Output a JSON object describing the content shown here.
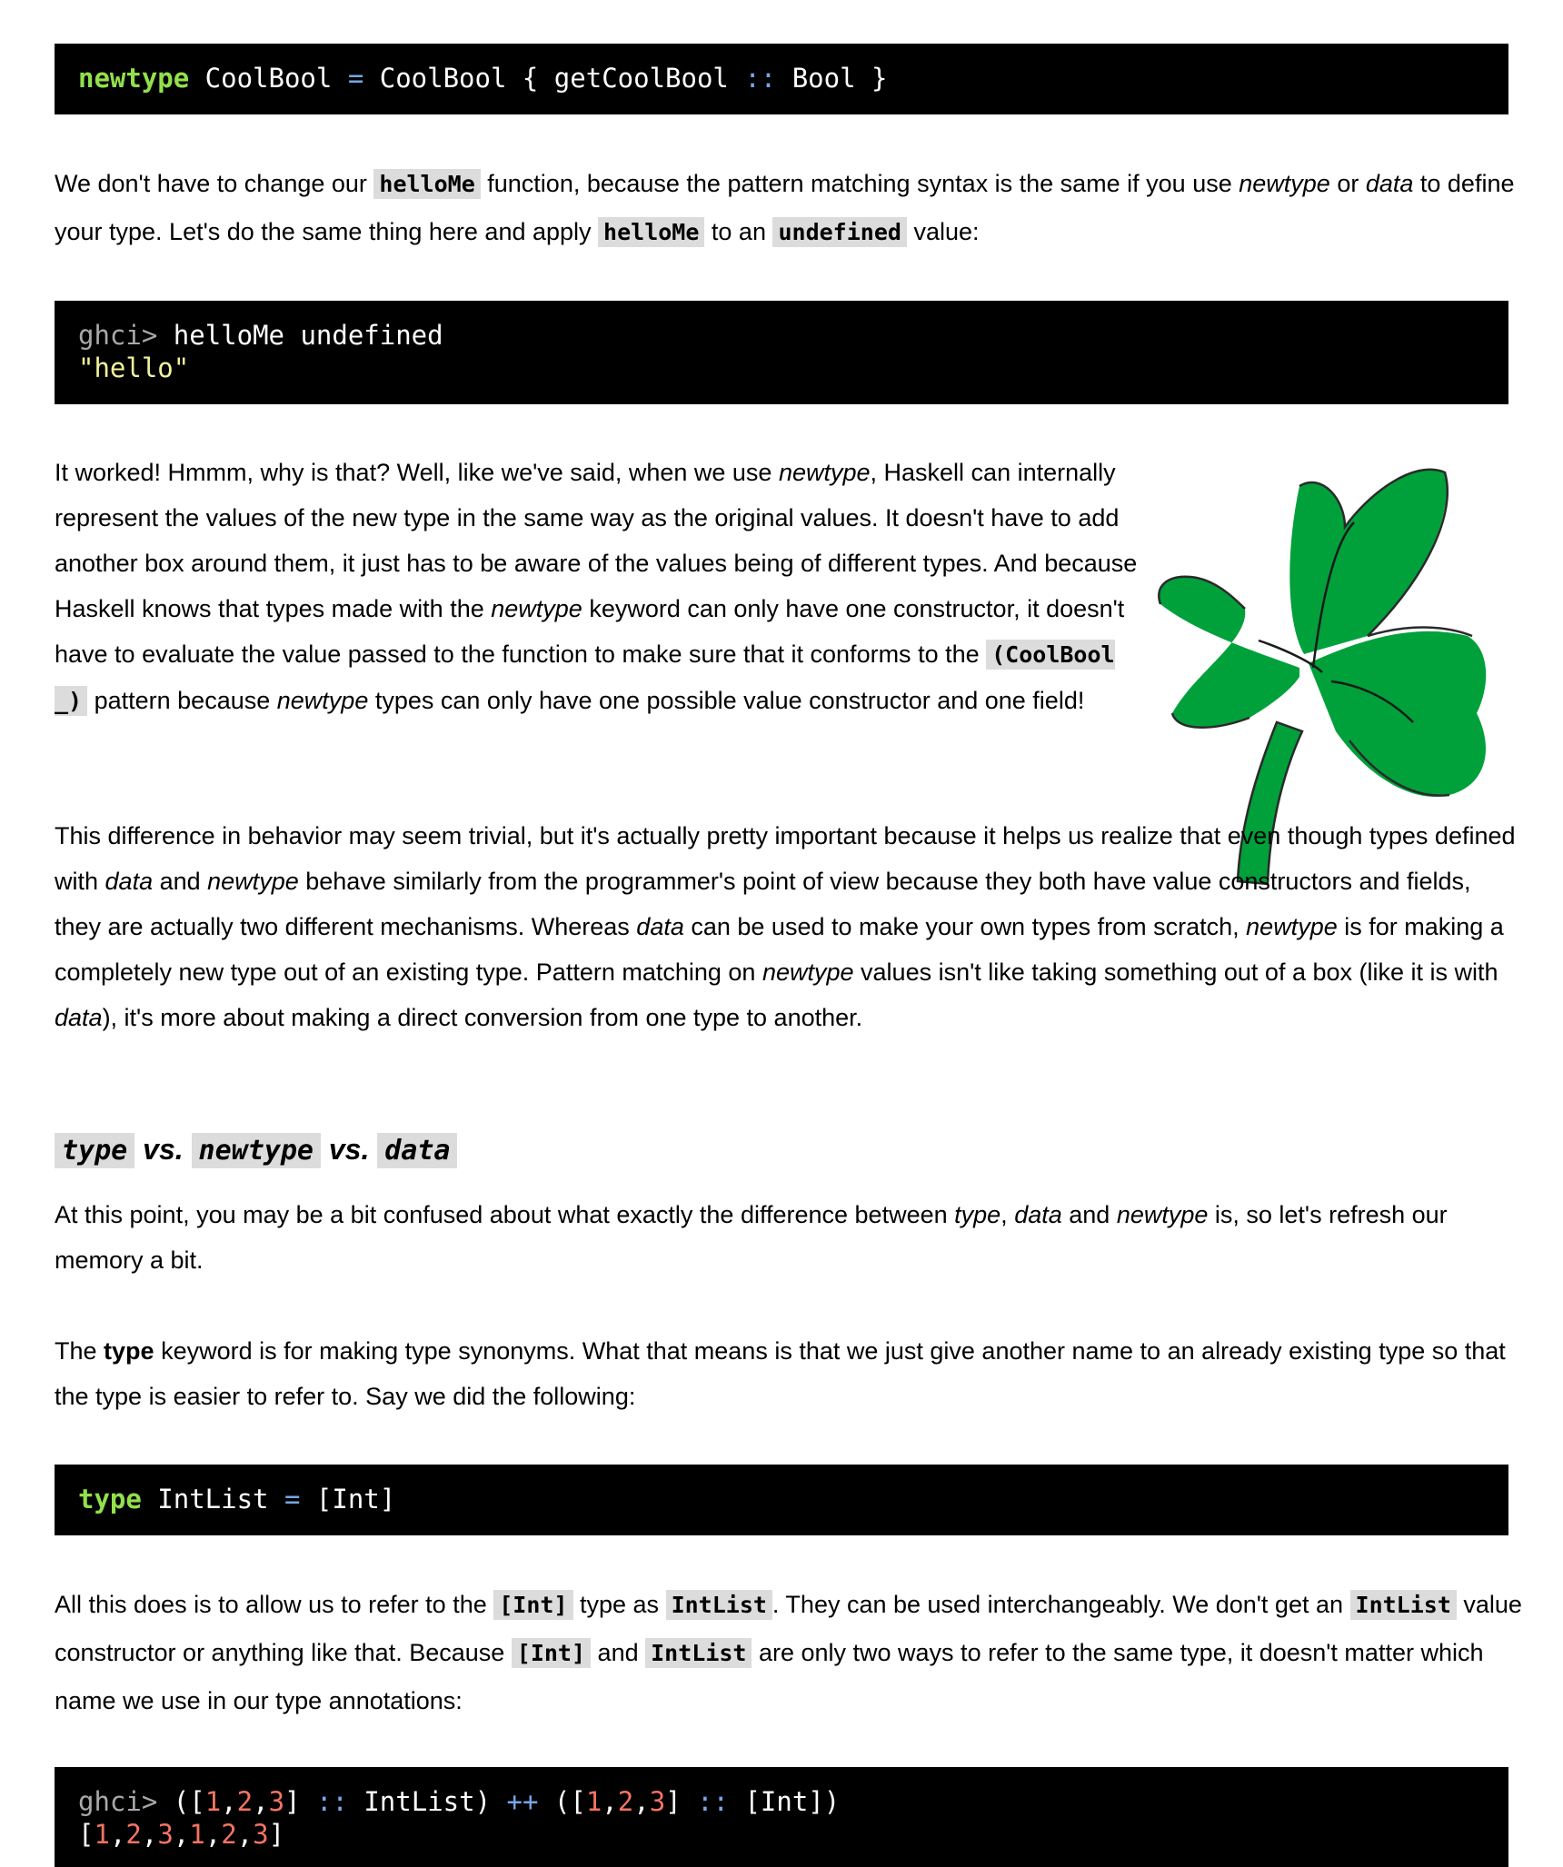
{
  "code1": {
    "kw": "newtype",
    "t1": " CoolBool ",
    "eq": "=",
    "t2": " CoolBool { getCoolBool ",
    "dc": "::",
    "t3": " Bool }"
  },
  "p1": {
    "a": "We don't have to change our ",
    "c1": "helloMe",
    "b": " function, because the pattern matching syntax is the same if you use ",
    "i1": "newtype",
    "c": " or ",
    "i2": "data",
    "d": " to define your type. Let's do the same thing here and apply ",
    "c2": "helloMe",
    "e": " to an ",
    "c3": "undefined",
    "f": " value:"
  },
  "code2": {
    "prompt": "ghci>",
    "cmd": " helloMe undefined",
    "result": "\"hello\""
  },
  "p2": {
    "a": "It worked! Hmmm, why is that? Well, like we've said, when we use ",
    "i1": "newtype",
    "b": ", Haskell can internally represent the values of the new type in the same way as the original values. It doesn't have to add another box around them, it just has to be aware of the values being of different types. And because Haskell knows that types made with the ",
    "i2": "newtype",
    "c": " keyword can only have one constructor, it doesn't have to evaluate the value passed to the function to make sure that it conforms to the ",
    "c1": "(CoolBool _)",
    "d": " pattern because ",
    "i3": "newtype",
    "e": " types can only have one possible value constructor and one field!"
  },
  "p3": {
    "a": "This difference in behavior may seem trivial, but it's actually pretty important because it helps us realize that even though types defined with ",
    "i1": "data",
    "b": " and ",
    "i2": "newtype",
    "c": " behave similarly from the programmer's point of view because they both have value constructors and fields, they are actually two different mechanisms. Whereas ",
    "i3": "data",
    "d": " can be used to make your own types from scratch, ",
    "i4": "newtype",
    "e": " is for making a completely new type out of an existing type. Pattern matching on ",
    "i5": "newtype",
    "f": " values isn't like taking something out of a box (like it is with ",
    "i6": "data",
    "g": "), it's more about making a direct conversion from one type to another."
  },
  "heading": {
    "c1": "type",
    "vs1": " vs. ",
    "c2": "newtype",
    "vs2": " vs. ",
    "c3": "data"
  },
  "p4": {
    "a": "At this point, you may be a bit confused about what exactly the difference between ",
    "i1": "type",
    "b": ", ",
    "i2": "data",
    "c": " and ",
    "i3": "newtype",
    "d": " is, so let's refresh our memory a bit."
  },
  "p5": {
    "a": "The ",
    "b1": "type",
    "b": " keyword is for making type synonyms. What that means is that we just give another name to an already existing type so that the type is easier to refer to. Say we did the following:"
  },
  "code3": {
    "kw": "type",
    "t1": " IntList ",
    "eq": "=",
    "t2": " [Int]"
  },
  "p6": {
    "a": "All this does is to allow us to refer to the ",
    "c1": "[Int]",
    "b": " type as ",
    "c2": "IntList",
    "c": ". They can be used interchangeably. We don't get an ",
    "c3": "IntList",
    "d": " value constructor or anything like that. Because ",
    "c4": "[Int]",
    "e": " and ",
    "c5": "IntList",
    "f": " are only two ways to refer to the same type, it doesn't matter which name we use in our type annotations:"
  },
  "code4": {
    "prompt": "ghci>",
    "l1a": " ([",
    "n1": "1",
    "s1": ",",
    "n2": "2",
    "s2": ",",
    "n3": "3",
    "l1b": "] ",
    "dc1": "::",
    "l1c": " IntList) ",
    "pp": "++",
    "l1d": " ([",
    "n4": "1",
    "s3": ",",
    "n5": "2",
    "s4": ",",
    "n6": "3",
    "l1e": "] ",
    "dc2": "::",
    "l1f": " [Int])",
    "r0": "[",
    "rn1": "1",
    "rs1": ",",
    "rn2": "2",
    "rs2": ",",
    "rn3": "3",
    "rs3": ",",
    "rn4": "1",
    "rs4": ",",
    "rn5": "2",
    "rs5": ",",
    "rn6": "3",
    "r1": "]"
  },
  "image": {
    "icon": "shamrock-clover-illustration",
    "fill": "#00a13a"
  }
}
